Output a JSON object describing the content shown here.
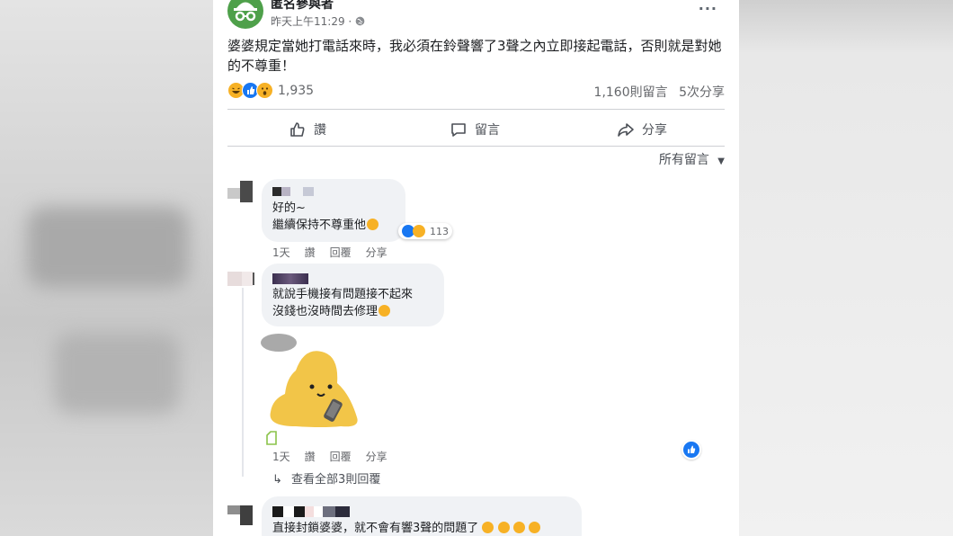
{
  "post": {
    "author": "匿名參與者",
    "time": "昨天上午11:29 ·",
    "more": "···",
    "text": "婆婆規定當她打電話來時，我必須在鈴聲響了3聲之內立即接起電話，否則就是對她的不尊重！",
    "reaction_count": "1,935",
    "comment_count": "1,160則留言",
    "share_count": "5次分享",
    "reactions": [
      "haha",
      "like",
      "wow"
    ]
  },
  "actions": {
    "like": "讚",
    "comment": "留言",
    "share": "分享"
  },
  "filter": "所有留言",
  "comments": [
    {
      "line1": "好的~",
      "line2": "繼續保持不尊重他",
      "reactions": [
        "like",
        "haha"
      ],
      "reaction_count": "113",
      "meta": {
        "time": "1天",
        "like": "讚",
        "reply": "回覆",
        "share": "分享"
      }
    },
    {
      "line1": "就說手機接有問題接不起來",
      "line2": "沒錢也沒時間去修理",
      "reactions": [
        "like"
      ],
      "meta": {
        "time": "1天",
        "like": "讚",
        "reply": "回覆",
        "share": "分享"
      },
      "view_replies": "查看全部3則回覆"
    },
    {
      "line1": "直接封鎖婆婆，就不會有響3聲的問題了"
    }
  ],
  "colors": {
    "accent": "#1877f2",
    "avatar": "#4ea04a",
    "sticker": "#f2c548"
  }
}
